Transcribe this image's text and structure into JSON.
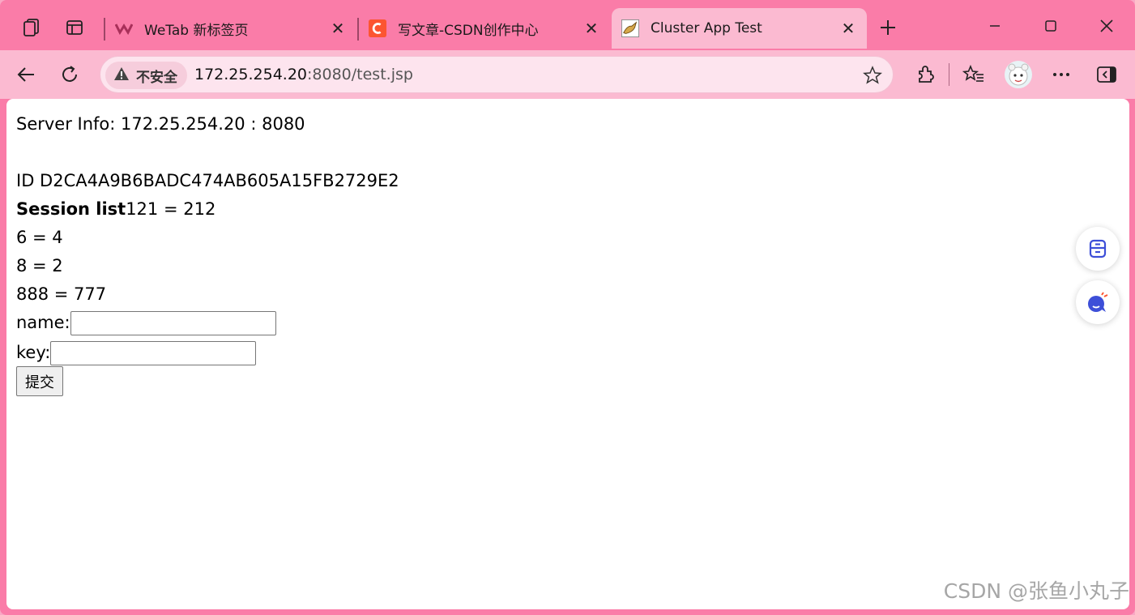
{
  "browser": {
    "tabs": [
      {
        "label": "WeTab 新标签页",
        "favicon": "wetab-icon",
        "active": false
      },
      {
        "label": "写文章-CSDN创作中心",
        "favicon": "csdn-icon",
        "active": false
      },
      {
        "label": "Cluster App Test",
        "favicon": "tomcat-icon",
        "active": true
      }
    ],
    "address_bar": {
      "security_label": "不安全",
      "url_host": "172.25.254.20",
      "url_rest": ":8080/test.jsp"
    }
  },
  "page": {
    "server_info": "Server Info: 172.25.254.20 : 8080",
    "session_id": "ID D2CA4A9B6BADC474AB605A15FB2729E2",
    "session_list_label": "Session list",
    "session_entries": [
      "121 = 212",
      "6 = 4",
      "8 = 2",
      "888 = 777"
    ],
    "name_label": "name:",
    "name_value": "",
    "key_label": "key:",
    "key_value": "",
    "submit_label": "提交"
  },
  "watermark": "CSDN @张鱼小丸子",
  "colors": {
    "frame": "#fa7ca8",
    "toolbar": "#fbbad1",
    "content": "#ffffff"
  }
}
